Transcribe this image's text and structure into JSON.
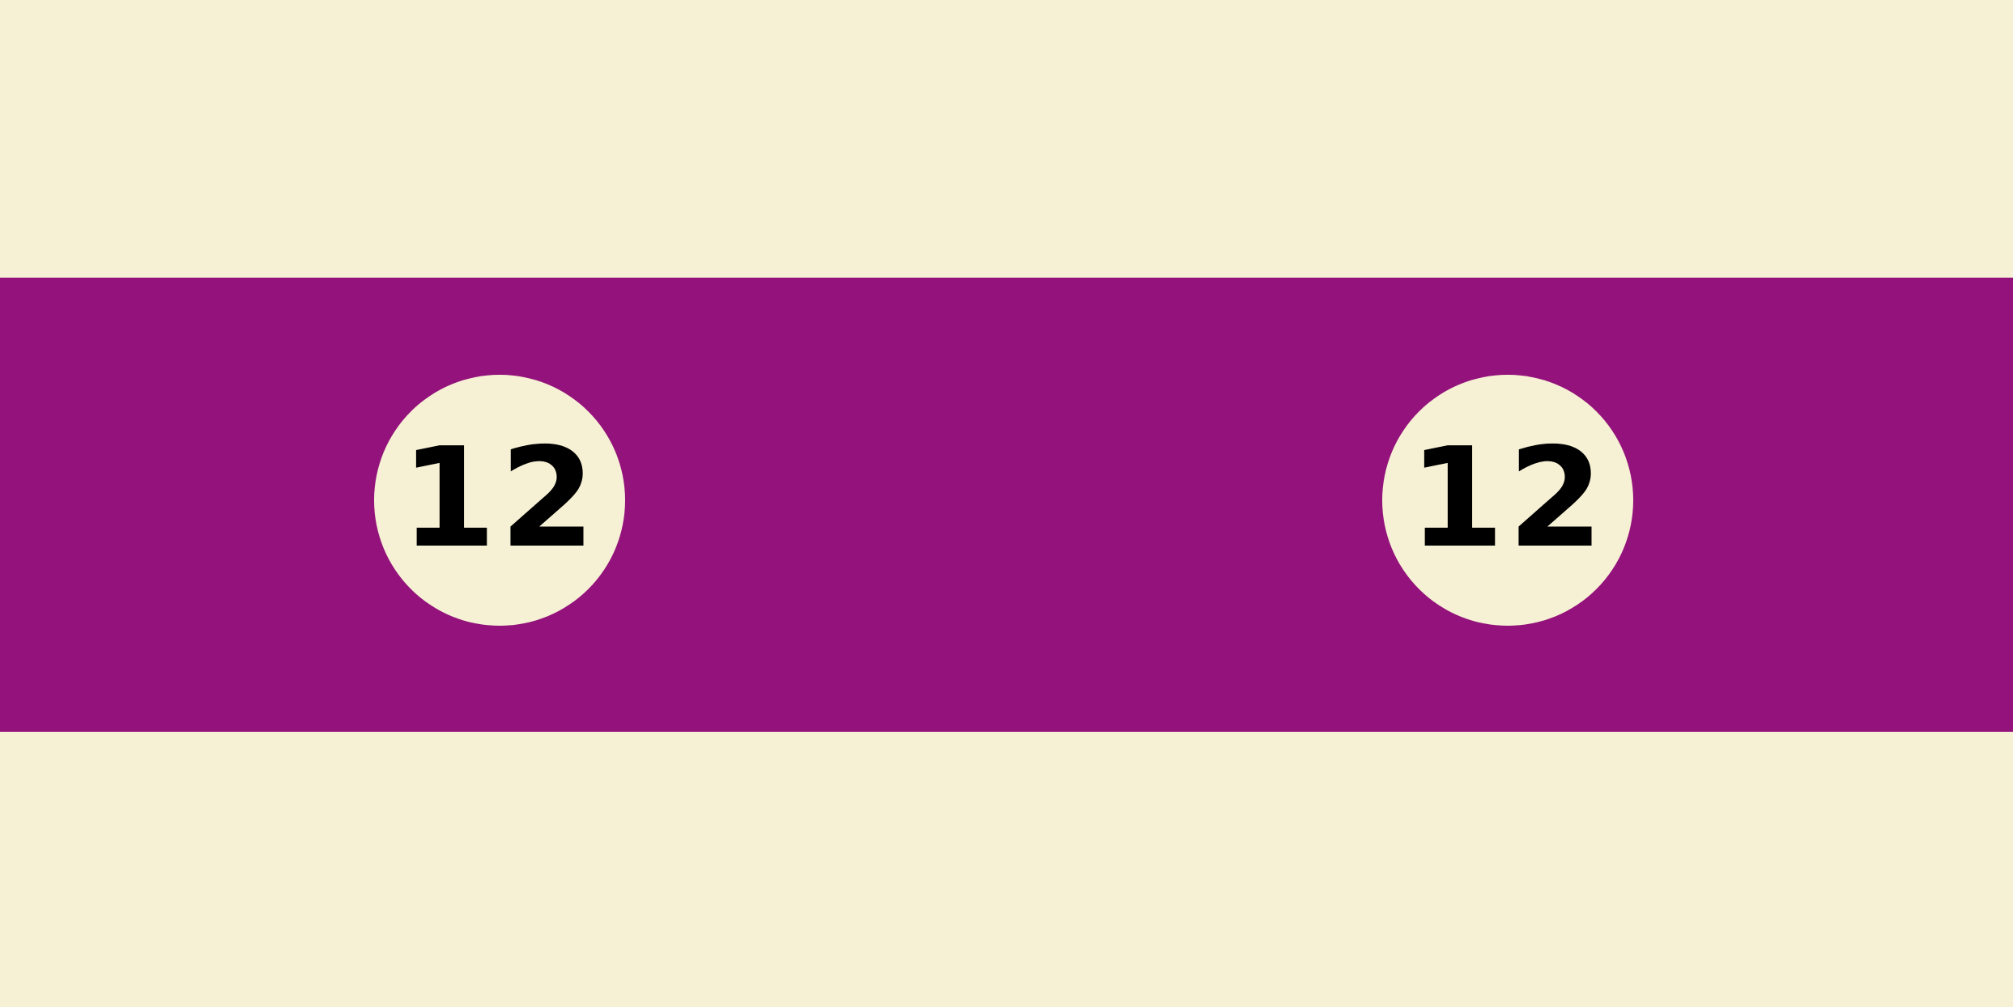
{
  "colors": {
    "background": "#f6f1d4",
    "band": "#93127b",
    "badge_fill": "#f6f1d4",
    "badge_text": "#000000"
  },
  "badges": [
    {
      "label": "12"
    },
    {
      "label": "12"
    }
  ]
}
